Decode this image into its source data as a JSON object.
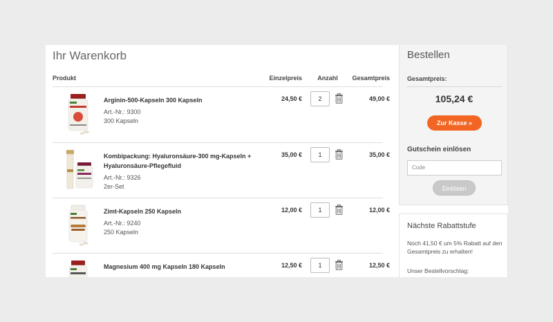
{
  "cart": {
    "title": "Ihr Warenkorb",
    "headers": {
      "product": "Produkt",
      "unit_price": "Einzelpreis",
      "quantity": "Anzahl",
      "total_price": "Gesamtpreis"
    },
    "items": [
      {
        "name": "Arginin-500-Kapseln 300 Kapseln",
        "article": "Art.-Nr.: 9300",
        "variant": "300 Kapseln",
        "unit_price": "24,50 €",
        "quantity": "2",
        "total": "49,00 €"
      },
      {
        "name": "Kombipackung: Hyaluronsäure-300 mg-Kapseln + Hyaluronsäure-Pflegefluid",
        "article": "Art.-Nr.: 9326",
        "variant": "2er-Set",
        "unit_price": "35,00 €",
        "quantity": "1",
        "total": "35,00 €"
      },
      {
        "name": "Zimt-Kapseln 250 Kapseln",
        "article": "Art.-Nr.: 9240",
        "variant": "250 Kapseln",
        "unit_price": "12,00 €",
        "quantity": "1",
        "total": "12,00 €"
      },
      {
        "name": "Magnesium 400 mg Kapseln 180 Kapseln",
        "article": "",
        "variant": "",
        "unit_price": "12,50 €",
        "quantity": "1",
        "total": "12,50 €"
      }
    ]
  },
  "order": {
    "title": "Bestellen",
    "total_label": "Gesamtpreis:",
    "total_amount": "105,24 €",
    "checkout_label": "Zur Kasse »",
    "voucher_label": "Gutschein einlösen",
    "code_placeholder": "Code",
    "redeem_label": "Einlösen"
  },
  "rabatt": {
    "title": "Nächste Rabattstufe",
    "text": "Noch 41,50 € um 5% Rabatt auf den Gesamtpreis zu erhalten!",
    "proposal_label": "Unser Bestellvorschlag:"
  },
  "colors": {
    "accent": "#f26522",
    "page_bg": "#ececec",
    "panel_bg": "#f4f4f4"
  }
}
